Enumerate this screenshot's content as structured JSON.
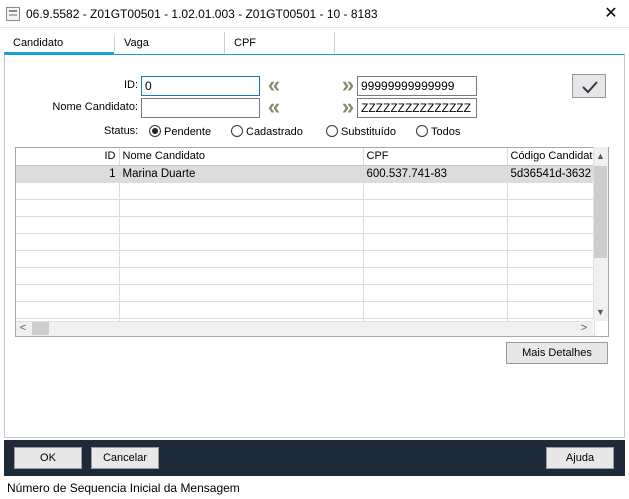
{
  "window": {
    "title": "06.9.5582 - Z01GT00501 - 1.02.01.003 - Z01GT00501 - 10 - 8183",
    "close_glyph": "✕"
  },
  "tabs": [
    {
      "label": "Candidato",
      "active": true
    },
    {
      "label": "Vaga",
      "active": false
    },
    {
      "label": "CPF",
      "active": false
    }
  ],
  "filters": {
    "id": {
      "label": "ID:",
      "from": "0",
      "to": "99999999999999"
    },
    "name": {
      "label": "Nome Candidato:",
      "from": "",
      "to": "ZZZZZZZZZZZZZZZ"
    },
    "first_glyph": "«",
    "last_glyph": "»"
  },
  "status": {
    "label": "Status:",
    "options": [
      {
        "label": "Pendente",
        "checked": true
      },
      {
        "label": "Cadastrado",
        "checked": false
      },
      {
        "label": "Substituído",
        "checked": false
      },
      {
        "label": "Todos",
        "checked": false
      }
    ]
  },
  "grid": {
    "columns": [
      "ID",
      "Nome Candidato",
      "CPF",
      "Código Candidato"
    ],
    "rows": [
      [
        "1",
        "Marina Duarte",
        "600.537.741-83",
        "5d36541d-3632"
      ]
    ],
    "scroll": {
      "up": "▲",
      "down": "▼",
      "left": "<",
      "right": ">"
    }
  },
  "buttons": {
    "mais_detalhes": "Mais Detalhes",
    "ok": "OK",
    "cancelar": "Cancelar",
    "ajuda": "Ajuda"
  },
  "status_bar": {
    "message": "Número de Sequencia Inicial da Mensagem"
  },
  "colors": {
    "accent": "#1aa0d8",
    "footer": "#1e2a37",
    "arrow": "#8b8b70"
  }
}
